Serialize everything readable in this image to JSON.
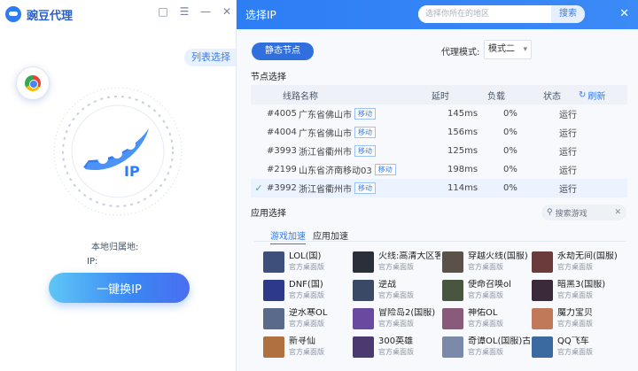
{
  "app": {
    "name": "豌豆代理"
  },
  "left": {
    "list_select": "列表选择",
    "local_location_label": "本地归属地:",
    "ip_label": "IP:",
    "switch_button": "一键换IP"
  },
  "right": {
    "title": "选择IP",
    "search_placeholder": "选择你所在的地区",
    "search_button": "搜索",
    "static_nodes": "静态节点",
    "mode_label": "代理模式:",
    "mode_value": "模式二",
    "nodes_title": "节点选择",
    "columns": {
      "name": "线路名称",
      "latency": "延时",
      "load": "负载",
      "state": "状态",
      "refresh": "刷新"
    },
    "rows": [
      {
        "id": "#4005",
        "name": "广东省佛山市",
        "tag": "移动",
        "latency": "145ms",
        "load": "0%",
        "state": "运行",
        "selected": false
      },
      {
        "id": "#4004",
        "name": "广东省佛山市",
        "tag": "移动",
        "latency": "156ms",
        "load": "0%",
        "state": "运行",
        "selected": false
      },
      {
        "id": "#3993",
        "name": "浙江省衢州市",
        "tag": "移动",
        "latency": "125ms",
        "load": "0%",
        "state": "运行",
        "selected": false
      },
      {
        "id": "#2199",
        "name": "山东省济南移动03",
        "tag": "移动",
        "latency": "198ms",
        "load": "0%",
        "state": "运行",
        "selected": false
      },
      {
        "id": "#3992",
        "name": "浙江省衢州市",
        "tag": "移动",
        "latency": "114ms",
        "load": "0%",
        "state": "运行",
        "selected": true
      }
    ],
    "apps_title": "应用选择",
    "game_search": "搜索游戏",
    "tabs": [
      {
        "label": "游戏加速",
        "active": true
      },
      {
        "label": "应用加速",
        "active": false
      }
    ],
    "games": [
      {
        "name": "LOL(国)",
        "sub": "官方桌面版",
        "color": "#3d4f7a"
      },
      {
        "name": "火线:高清大区客",
        "sub": "官方桌面版",
        "color": "#2a2f3a"
      },
      {
        "name": "穿越火线(国服)",
        "sub": "官方桌面版",
        "color": "#5a5248"
      },
      {
        "name": "永劫无间(国服)",
        "sub": "官方桌面版",
        "color": "#6b3a3a"
      },
      {
        "name": "DNF(国)",
        "sub": "官方桌面版",
        "color": "#2b3a8a"
      },
      {
        "name": "逆战",
        "sub": "官方桌面版",
        "color": "#3a4a66"
      },
      {
        "name": "使命召唤ol",
        "sub": "官方桌面版",
        "color": "#4a5540"
      },
      {
        "name": "暗黑3(国服)",
        "sub": "官方桌面版",
        "color": "#3a2a3a"
      },
      {
        "name": "逆水寒OL",
        "sub": "官方桌面版",
        "color": "#5a6a8a"
      },
      {
        "name": "冒险岛2(国服)",
        "sub": "官方桌面版",
        "color": "#6a4aa0"
      },
      {
        "name": "神佑OL",
        "sub": "官方桌面版",
        "color": "#8a5a7a"
      },
      {
        "name": "魔力宝贝",
        "sub": "官方桌面版",
        "color": "#c07a5a"
      },
      {
        "name": "新寻仙",
        "sub": "官方桌面版",
        "color": "#b07040"
      },
      {
        "name": "300英雄",
        "sub": "官方桌面版",
        "color": "#4a3a70"
      },
      {
        "name": "奇谭OL(国服)古",
        "sub": "官方桌面版",
        "color": "#7a8aa8"
      },
      {
        "name": "QQ飞车",
        "sub": "官方桌面版",
        "color": "#3a6aa0"
      }
    ]
  }
}
